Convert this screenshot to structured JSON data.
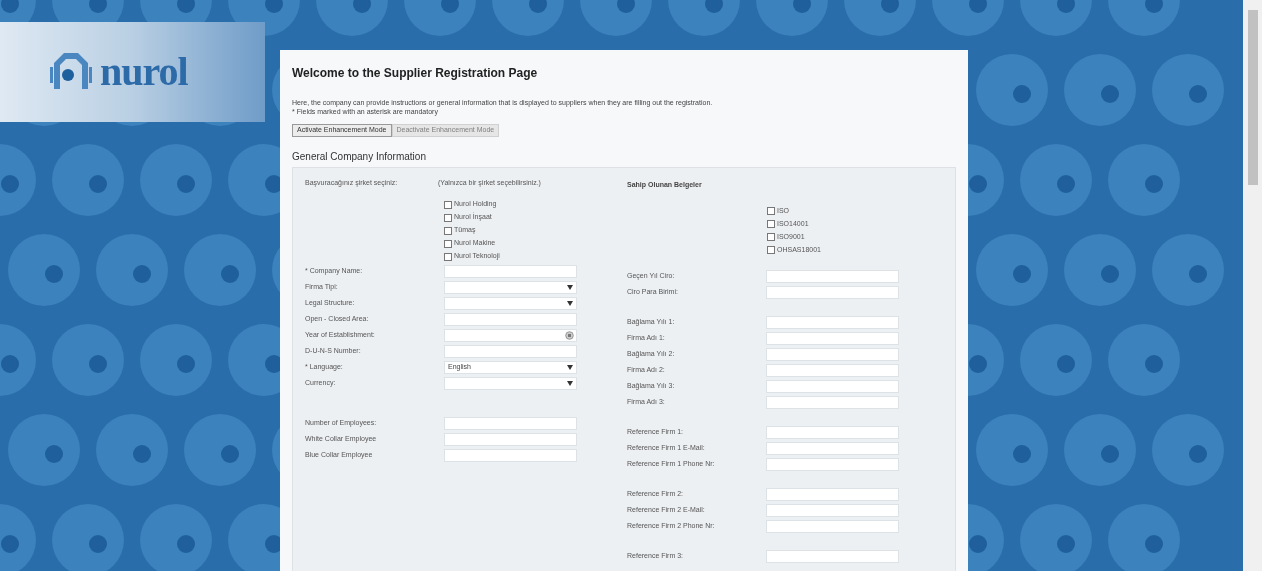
{
  "logo": {
    "wordmark": "nurol"
  },
  "page": {
    "title": "Welcome to the Supplier Registration Page",
    "description": [
      "Here, the company can provide instructions or general information that is displayed to suppliers when they are filling out the registration.",
      "* Fields marked with an asterisk are mandatory"
    ],
    "buttons": [
      {
        "label": "Activate Enhancement Mode",
        "disabled": false
      },
      {
        "label": "Deactivate Enhancement Mode",
        "disabled": true
      }
    ],
    "section_title": "General Company Information"
  },
  "left_column": {
    "company_selection": {
      "label": "Başvuracağınız şirket seçiniz:",
      "hint": "(Yalnızca bir şirket seçebilirsiniz.)",
      "options": [
        {
          "label": "Nurol Holding",
          "checked": false
        },
        {
          "label": "Nurol İnşaat",
          "checked": false
        },
        {
          "label": "Tümaş",
          "checked": false
        },
        {
          "label": "Nurol Makine",
          "checked": false
        },
        {
          "label": "Nurol Teknoloji",
          "checked": false
        }
      ]
    },
    "groups": [
      [
        {
          "label": "* Company Name:",
          "kind": "text"
        },
        {
          "label": "Firma Tipi:",
          "kind": "select"
        },
        {
          "label": "Legal Structure:",
          "kind": "select"
        },
        {
          "label": "Open - Closed Area:",
          "kind": "text"
        },
        {
          "label": "Year of Establishment:",
          "kind": "date"
        },
        {
          "label": "D-U-N-S Number:",
          "kind": "text"
        },
        {
          "label": "* Language:",
          "kind": "select",
          "value": "English"
        },
        {
          "label": "Currency:",
          "kind": "select"
        }
      ],
      [
        {
          "label": "Number of Employees:",
          "kind": "text"
        },
        {
          "label": "White Collar Employee",
          "kind": "text"
        },
        {
          "label": "Blue Collar Employee",
          "kind": "text"
        }
      ]
    ]
  },
  "right_column": {
    "certificates": {
      "heading": "Sahip Olunan Belgeler",
      "options": [
        {
          "label": "ISO",
          "checked": false
        },
        {
          "label": "ISO14001",
          "checked": false
        },
        {
          "label": "ISO9001",
          "checked": false
        },
        {
          "label": "OHSAS18001",
          "checked": false
        }
      ]
    },
    "groups": [
      [
        {
          "label": "Geçen Yıl Ciro:",
          "kind": "text"
        },
        {
          "label": "Ciro Para Birimi:",
          "kind": "text"
        }
      ],
      [
        {
          "label": "Bağlama Yılı 1:",
          "kind": "text"
        },
        {
          "label": "Firma Adı 1:",
          "kind": "text"
        },
        {
          "label": "Bağlama Yılı 2:",
          "kind": "text"
        },
        {
          "label": "Firma Adı 2:",
          "kind": "text"
        },
        {
          "label": "Bağlama Yılı 3:",
          "kind": "text"
        },
        {
          "label": "Firma Adı 3:",
          "kind": "text"
        }
      ],
      [
        {
          "label": "Reference Firm 1:",
          "kind": "text"
        },
        {
          "label": "Reference Firm 1 E-Mail:",
          "kind": "text"
        },
        {
          "label": "Reference Firm 1 Phone Nr:",
          "kind": "text"
        }
      ],
      [
        {
          "label": "Reference Firm 2:",
          "kind": "text"
        },
        {
          "label": "Reference Firm 2 E-Mail:",
          "kind": "text"
        },
        {
          "label": "Reference Firm 2 Phone Nr:",
          "kind": "text"
        }
      ],
      [
        {
          "label": "Reference Firm 3:",
          "kind": "text"
        }
      ]
    ]
  }
}
